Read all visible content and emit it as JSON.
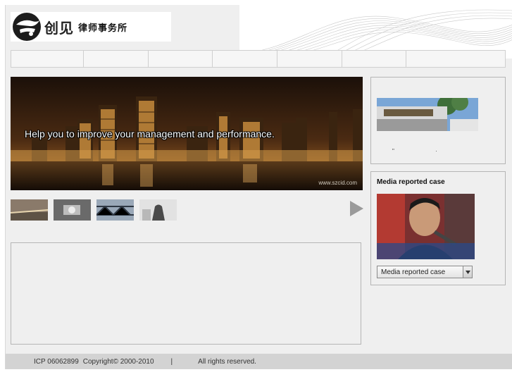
{
  "header": {
    "brand": "创见",
    "subtitle": "律师事务所"
  },
  "nav": {
    "items": [
      "",
      "",
      "",
      "",
      "",
      "",
      ""
    ]
  },
  "banner": {
    "caption": "Help you to improve your management and performance.",
    "watermark": "www.szcid.com"
  },
  "sidebar_top": {
    "dots": "\" ·"
  },
  "media_box": {
    "title": "Media reported case",
    "select_value": "Media reported case"
  },
  "footer": {
    "icp": "ICP 06062899",
    "copyright": "Copyright© 2000-2010",
    "separator": "|",
    "rights": "All rights reserved."
  },
  "icons": {
    "next": "play-triangle-icon",
    "dropdown": "triangle-down-icon"
  },
  "colors": {
    "page_bg": "#efefef",
    "border": "#b5b5b5",
    "footer_bg": "#d3d3d3",
    "arrow": "#9a9a9a"
  }
}
